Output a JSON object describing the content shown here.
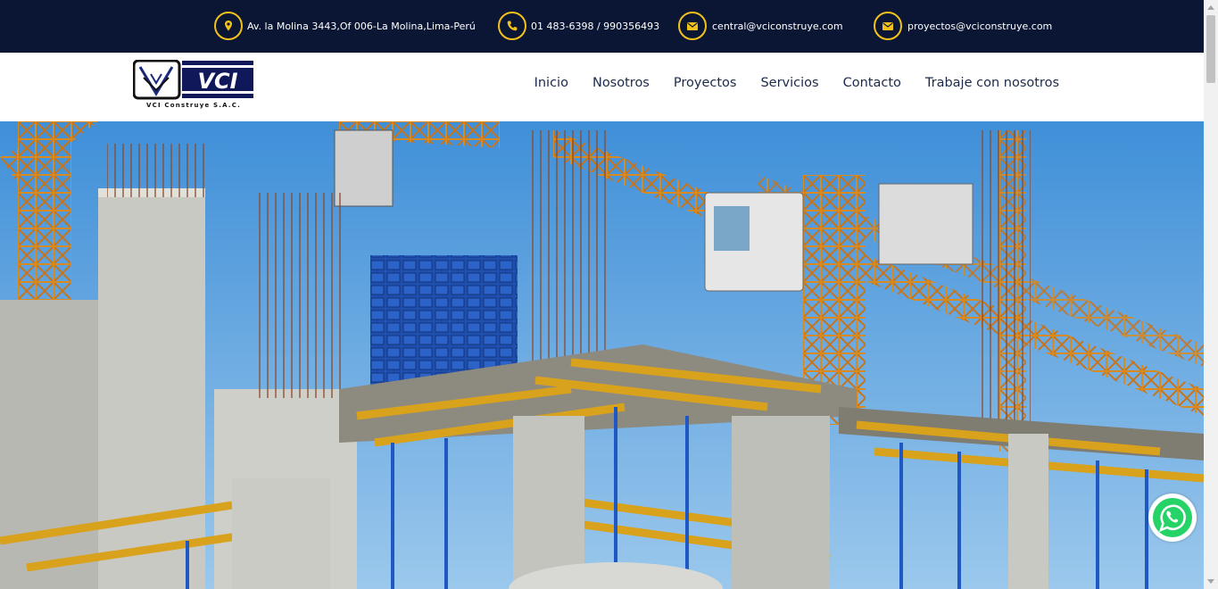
{
  "colors": {
    "topbar_bg": "#0b1634",
    "accent": "#f2c21b",
    "nav_text": "#1c2a4a",
    "whatsapp": "#25d366"
  },
  "topbar": {
    "address": {
      "icon": "map-marker-icon",
      "text": "Av. la Molina 3443,Of 006-La Molina,Lima-Perú"
    },
    "phone": {
      "icon": "phone-icon",
      "text": "01 483-6398 / 990356493"
    },
    "email_central": {
      "icon": "envelope-icon",
      "text": "central@vciconstruye.com"
    },
    "email_projects": {
      "icon": "envelope-icon",
      "text": "proyectos@vciconstruye.com"
    }
  },
  "logo": {
    "mark": "VCI",
    "tagline": "VCI Construye S.A.C."
  },
  "nav": {
    "items": [
      {
        "label": "Inicio"
      },
      {
        "label": "Nosotros"
      },
      {
        "label": "Proyectos"
      },
      {
        "label": "Servicios"
      },
      {
        "label": "Contacto"
      },
      {
        "label": "Trabaje con nosotros"
      }
    ]
  },
  "hero": {
    "image": "construction-site-photo"
  },
  "whatsapp": {
    "icon": "whatsapp-icon"
  }
}
